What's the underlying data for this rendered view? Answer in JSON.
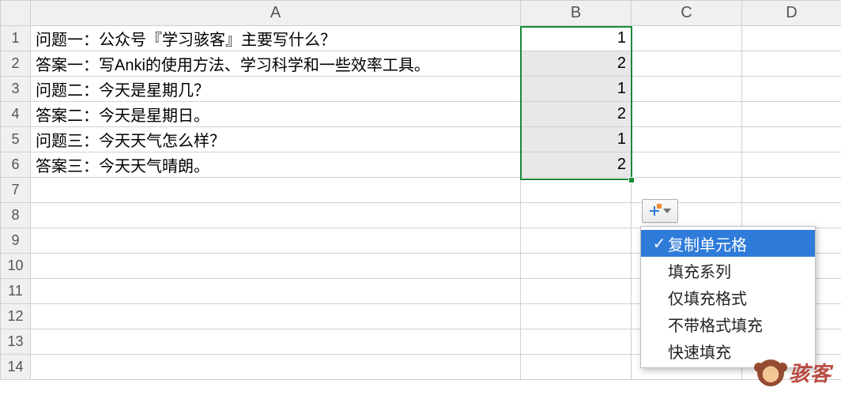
{
  "columns": {
    "A": "A",
    "B": "B",
    "C": "C",
    "D": "D"
  },
  "row_labels": [
    "1",
    "2",
    "3",
    "4",
    "5",
    "6",
    "7",
    "8",
    "9",
    "10",
    "11",
    "12",
    "13",
    "14"
  ],
  "cells": {
    "A1": "问题一：公众号『学习骇客』主要写什么？",
    "A2": "答案一：写Anki的使用方法、学习科学和一些效率工具。",
    "A3": "问题二：今天是星期几？",
    "A4": "答案二：今天是星期日。",
    "A5": "问题三：今天天气怎么样？",
    "A6": "答案三：今天天气晴朗。",
    "B1": "1",
    "B2": "2",
    "B3": "1",
    "B4": "2",
    "B5": "1",
    "B6": "2"
  },
  "selection": {
    "range": "B1:B6",
    "active_cell": "B1"
  },
  "autofill_menu": {
    "items": [
      {
        "label": "复制单元格",
        "checked": true
      },
      {
        "label": "填充系列",
        "checked": false
      },
      {
        "label": "仅填充格式",
        "checked": false
      },
      {
        "label": "不带格式填充",
        "checked": false
      },
      {
        "label": "快速填充",
        "checked": false
      }
    ]
  },
  "watermark": "骇客"
}
